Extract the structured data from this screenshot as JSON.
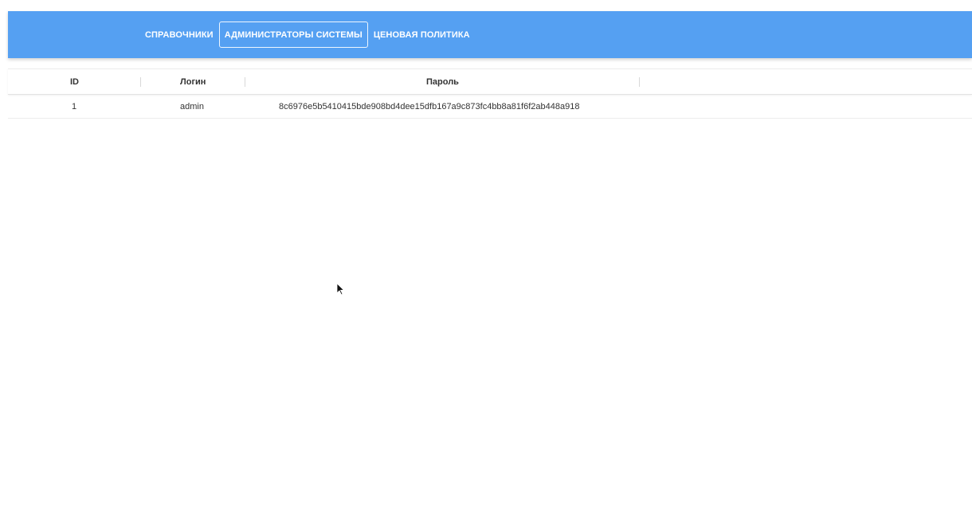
{
  "nav": {
    "tabs": [
      {
        "label": "СПРАВОЧНИКИ",
        "active": false
      },
      {
        "label": "АДМИНИСТРАТОРЫ СИСТЕМЫ",
        "active": true
      },
      {
        "label": "ЦЕНОВАЯ ПОЛИТИКА",
        "active": false
      }
    ]
  },
  "table": {
    "columns": [
      "ID",
      "Логин",
      "Пароль"
    ],
    "rows": [
      {
        "id": "1",
        "login": "admin",
        "password": "8c6976e5b5410415bde908bd4dee15dfb167a9c873fc4bb8a81f6f2ab448a918"
      }
    ]
  },
  "colors": {
    "appbar": "#55a0f2",
    "tab_text": "#ffffff"
  },
  "icons": {
    "cursor": "mouse-pointer-icon"
  }
}
